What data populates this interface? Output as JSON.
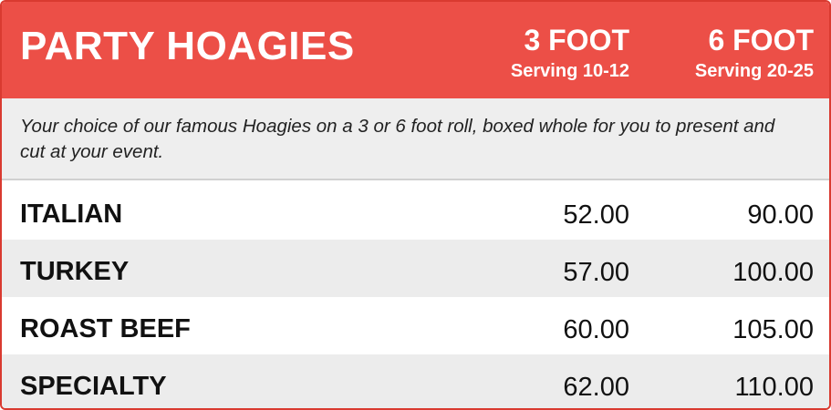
{
  "header": {
    "title": "PARTY HOAGIES",
    "columns": [
      {
        "size": "3 FOOT",
        "serving": "Serving 10-12"
      },
      {
        "size": "6 FOOT",
        "serving": "Serving 20-25"
      }
    ]
  },
  "description": "Your choice of our famous Hoagies on  a 3 or 6 foot roll, boxed whole for you to present and cut at your event.",
  "items": [
    {
      "name": "ITALIAN",
      "price_3ft": "52.00",
      "price_6ft": "90.00"
    },
    {
      "name": "TURKEY",
      "price_3ft": "57.00",
      "price_6ft": "100.00"
    },
    {
      "name": "ROAST BEEF",
      "price_3ft": "60.00",
      "price_6ft": "105.00"
    },
    {
      "name": "SPECIALTY",
      "price_3ft": "62.00",
      "price_6ft": "110.00"
    }
  ],
  "colors": {
    "header_bg": "#ec4f47",
    "border": "#d93a30",
    "alt_row": "#ececec"
  }
}
